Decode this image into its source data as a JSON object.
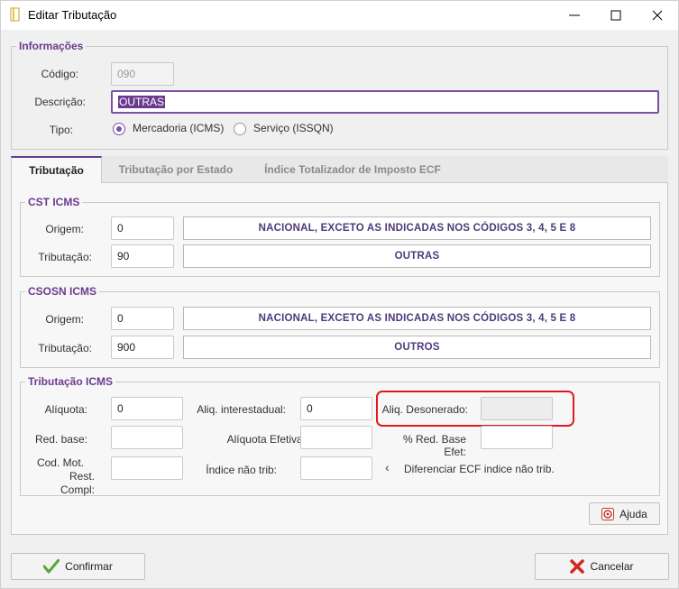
{
  "window": {
    "title": "Editar Tributação"
  },
  "informacoes": {
    "title": "Informações",
    "codigo_label": "Código:",
    "codigo_value": "090",
    "descricao_label": "Descrição:",
    "descricao_value": "OUTRAS",
    "tipo_label": "Tipo:",
    "tipo_options": [
      {
        "label": "Mercadoria (ICMS)",
        "selected": true
      },
      {
        "label": "Serviço (ISSQN)",
        "selected": false
      }
    ]
  },
  "tabs": [
    {
      "label": "Tributação",
      "active": true
    },
    {
      "label": "Tributação por Estado",
      "active": false
    },
    {
      "label": "Índice Totalizador de Imposto ECF",
      "active": false
    }
  ],
  "cst_icms": {
    "title": "CST ICMS",
    "origem_label": "Origem:",
    "origem_value": "0",
    "origem_desc": "NACIONAL, EXCETO AS INDICADAS NOS CÓDIGOS 3, 4, 5 E 8",
    "tributacao_label": "Tributação:",
    "tributacao_value": "90",
    "tributacao_desc": "OUTRAS"
  },
  "csosn_icms": {
    "title": "CSOSN ICMS",
    "origem_label": "Origem:",
    "origem_value": "0",
    "origem_desc": "NACIONAL, EXCETO AS INDICADAS NOS CÓDIGOS 3, 4, 5 E 8",
    "tributacao_label": "Tributação:",
    "tributacao_value": "900",
    "tributacao_desc": "OUTROS"
  },
  "tributacao_icms": {
    "title": "Tributação ICMS",
    "aliquota_label": "Alíquota:",
    "aliquota_value": "0",
    "aliq_interestadual_label": "Aliq. interestadual:",
    "aliq_interestadual_value": "0",
    "aliq_desonerado_label": "Aliq. Desonerado:",
    "aliq_desonerado_value": "",
    "red_base_label": "Red. base:",
    "red_base_value": "",
    "aliquota_efetiva_label": "Alíquota Efetiva:",
    "aliquota_efetiva_value": "",
    "pct_red_base_efet_label": "% Red. Base Efet:",
    "pct_red_base_efet_value": "",
    "cod_mot_label_line1": "Cod. Mot.",
    "cod_mot_label_line2": "Rest. Compl:",
    "cod_mot_value": "",
    "indice_nao_trib_label": "Índice não trib:",
    "indice_nao_trib_value": "",
    "diferenciar_label": "Diferenciar ECF indice não trib."
  },
  "buttons": {
    "ajuda": "Ajuda",
    "confirmar": "Confirmar",
    "cancelar": "Cancelar"
  },
  "colors": {
    "accent": "#6b3a8e",
    "highlight": "#e0191e"
  }
}
